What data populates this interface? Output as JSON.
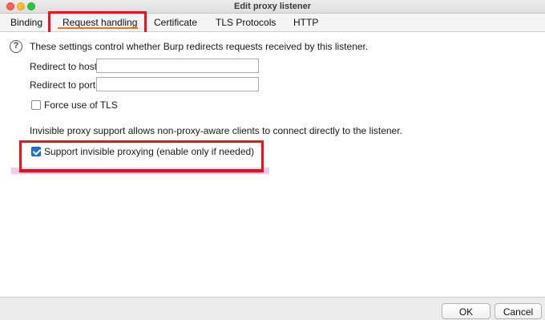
{
  "window": {
    "title": "Edit proxy listener"
  },
  "tabs": [
    {
      "label": "Binding"
    },
    {
      "label": "Request handling",
      "active": true
    },
    {
      "label": "Certificate"
    },
    {
      "label": "TLS Protocols"
    },
    {
      "label": "HTTP"
    }
  ],
  "main": {
    "description": "These settings control whether Burp redirects requests received by this listener.",
    "redirect_host_label": "Redirect to host:",
    "redirect_host_value": "",
    "redirect_port_label": "Redirect to port:",
    "redirect_port_value": "",
    "force_tls_label": "Force use of TLS",
    "force_tls_checked": false,
    "invisible_description": "Invisible proxy support allows non-proxy-aware clients to connect directly to the listener.",
    "invisible_label": "Support invisible proxying (enable only if needed)",
    "invisible_checked": true
  },
  "footer": {
    "ok_label": "OK",
    "cancel_label": "Cancel"
  },
  "colors": {
    "highlight": "#e8141a",
    "accent": "#e8742a",
    "checkbox": "#1e6fd9"
  }
}
